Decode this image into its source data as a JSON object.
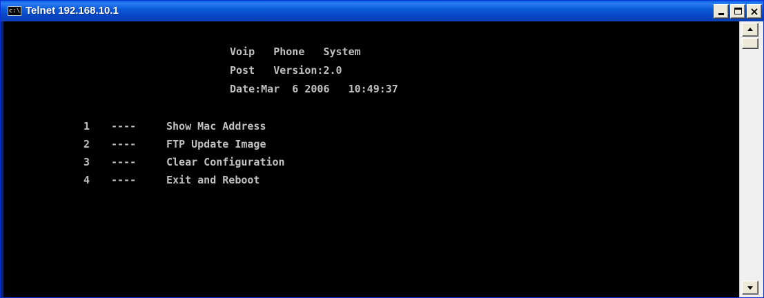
{
  "window": {
    "title": "Telnet 192.168.10.1",
    "icon_text": "c:\\",
    "icon": "console-icon",
    "controls": {
      "minimize": "minimize-icon",
      "maximize": "maximize-icon",
      "close_label": "×"
    }
  },
  "console": {
    "header": {
      "line1": "Voip   Phone   System",
      "line2": "Post   Version:2.0",
      "line3": "Date:Mar  6 2006   10:49:37"
    },
    "menu": [
      {
        "number": "1",
        "dashes": "----",
        "label": "Show Mac Address"
      },
      {
        "number": "2",
        "dashes": "----",
        "label": "FTP Update Image"
      },
      {
        "number": "3",
        "dashes": "----",
        "label": "Clear Configuration"
      },
      {
        "number": "4",
        "dashes": "----",
        "label": "Exit and Reboot"
      }
    ]
  },
  "colors": {
    "console_bg": "#000000",
    "console_text": "#c0c0c0",
    "titlebar": "#0a5fe0"
  }
}
